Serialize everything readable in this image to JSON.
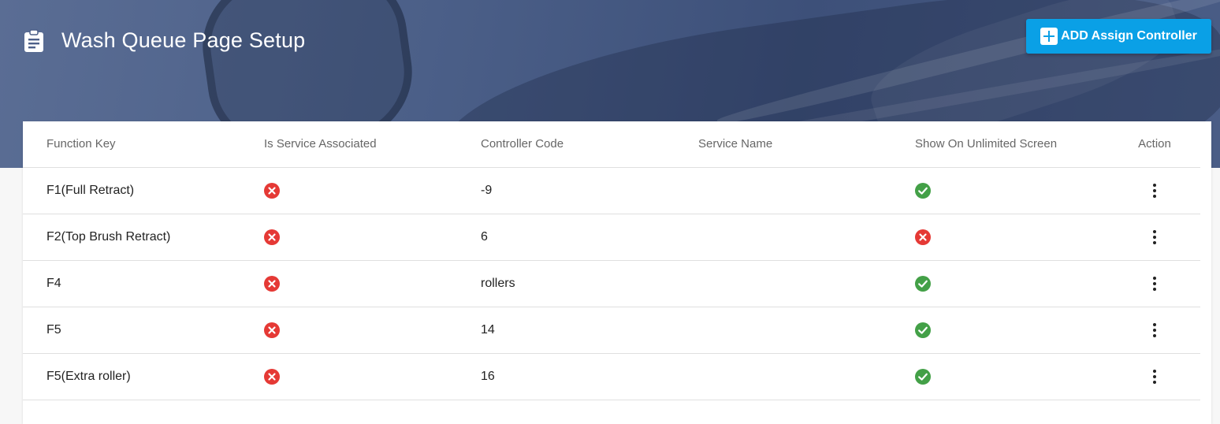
{
  "header": {
    "title": "Wash Queue Page Setup",
    "title_icon": "clipboard-icon",
    "add_button_label": "ADD Assign Controller",
    "add_button_icon": "plus-box-icon"
  },
  "colors": {
    "accent": "#0aa0e6",
    "no": "#e53935",
    "yes": "#43a047"
  },
  "table": {
    "columns": [
      "Function Key",
      "Is Service Associated",
      "Controller Code",
      "Service Name",
      "Show On Unlimited Screen",
      "Action"
    ],
    "rows": [
      {
        "function_key": "F1(Full Retract)",
        "is_service_associated": false,
        "controller_code": "-9",
        "service_name": "",
        "show_on_unlimited_screen": true
      },
      {
        "function_key": "F2(Top Brush Retract)",
        "is_service_associated": false,
        "controller_code": "6",
        "service_name": "",
        "show_on_unlimited_screen": false
      },
      {
        "function_key": "F4",
        "is_service_associated": false,
        "controller_code": "rollers",
        "service_name": "",
        "show_on_unlimited_screen": true
      },
      {
        "function_key": "F5",
        "is_service_associated": false,
        "controller_code": "14",
        "service_name": "",
        "show_on_unlimited_screen": true
      },
      {
        "function_key": "F5(Extra roller)",
        "is_service_associated": false,
        "controller_code": "16",
        "service_name": "",
        "show_on_unlimited_screen": true
      }
    ]
  }
}
